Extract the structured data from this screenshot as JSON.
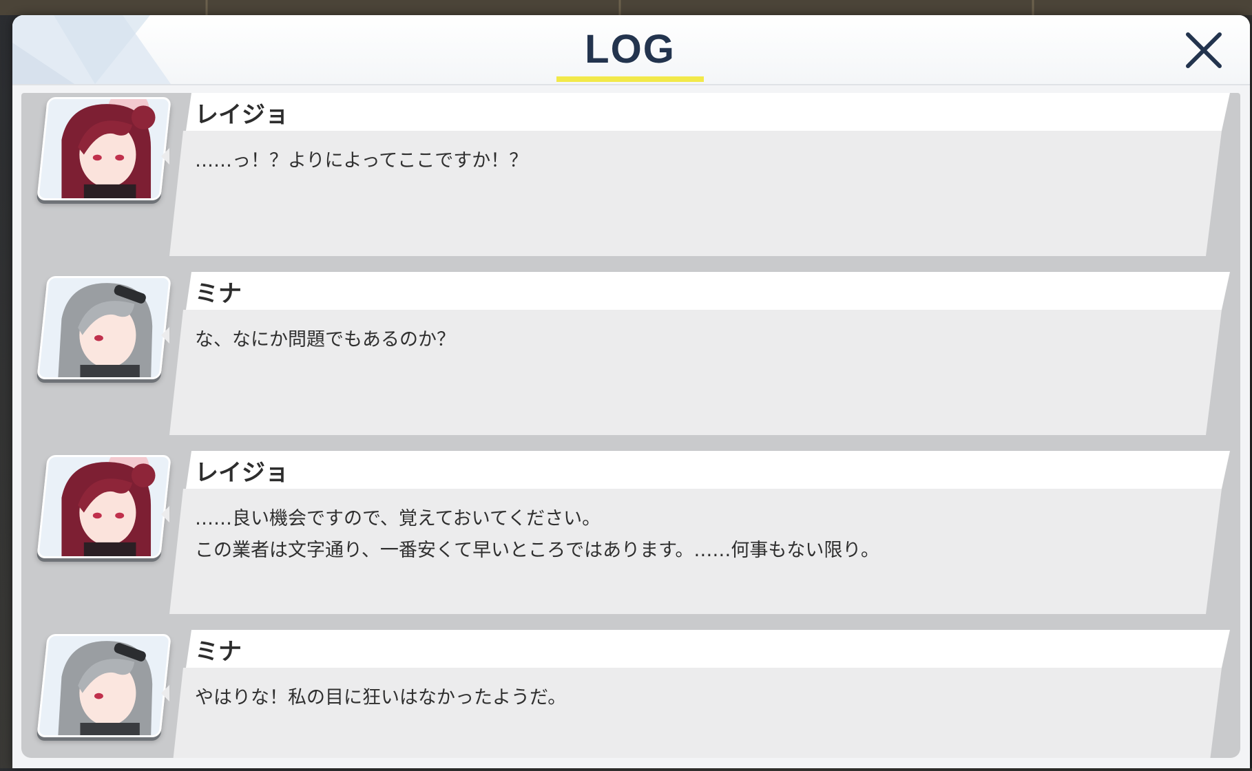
{
  "dialog": {
    "title": "LOG",
    "close_icon": "close-icon"
  },
  "colors": {
    "accent_underline": "#f2e94a",
    "title_text": "#23344e"
  },
  "entries": [
    {
      "speaker": "レイジョ",
      "portrait": "reijo-portrait",
      "lines": [
        "……っ！？よりによってここですか！？"
      ]
    },
    {
      "speaker": "ミナ",
      "portrait": "mina-portrait",
      "lines": [
        "な、なにか問題でもあるのか？"
      ]
    },
    {
      "speaker": "レイジョ",
      "portrait": "reijo-portrait",
      "lines": [
        "……良い機会ですので、覚えておいてください。",
        "この業者は文字通り、一番安くて早いところではあります。……何事もない限り。"
      ]
    },
    {
      "speaker": "ミナ",
      "portrait": "mina-portrait",
      "lines": [
        "やはりな！私の目に狂いはなかったようだ。"
      ]
    }
  ]
}
